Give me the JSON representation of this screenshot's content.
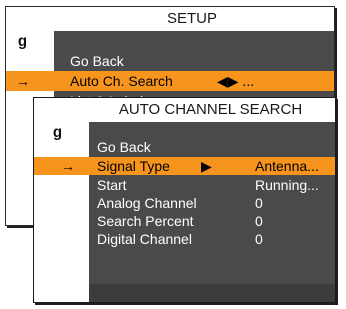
{
  "setup_menu": {
    "title": "SETUP",
    "items": [
      {
        "label": "Go Back",
        "arrow": "",
        "nav": ""
      },
      {
        "label": "Auto Ch. Search",
        "arrow": "→",
        "nav": "◀▶ ..."
      },
      {
        "label": "List & Label",
        "arrow": "",
        "nav": ""
      }
    ]
  },
  "auto_channel_search": {
    "title": "AUTO CHANNEL SEARCH",
    "items": [
      {
        "label": "Go Back",
        "arrow": "",
        "nav": "",
        "value": ""
      },
      {
        "label": "Signal Type",
        "arrow": "→",
        "nav": "▶",
        "value": "Antenna..."
      },
      {
        "label": "Start",
        "arrow": "",
        "nav": "",
        "value": "Running..."
      },
      {
        "label": "Analog Channel",
        "arrow": "",
        "nav": "",
        "value": "0"
      },
      {
        "label": "Search Percent",
        "arrow": "",
        "nav": "",
        "value": "0"
      },
      {
        "label": "Digital Channel",
        "arrow": "",
        "nav": "",
        "value": "0"
      }
    ]
  },
  "icons": {
    "tv_input_icon": "⏻"
  },
  "colors": {
    "panel_bg": "#4a4a4a",
    "highlight": "#f7941d",
    "title_bg": "#ffffff"
  }
}
